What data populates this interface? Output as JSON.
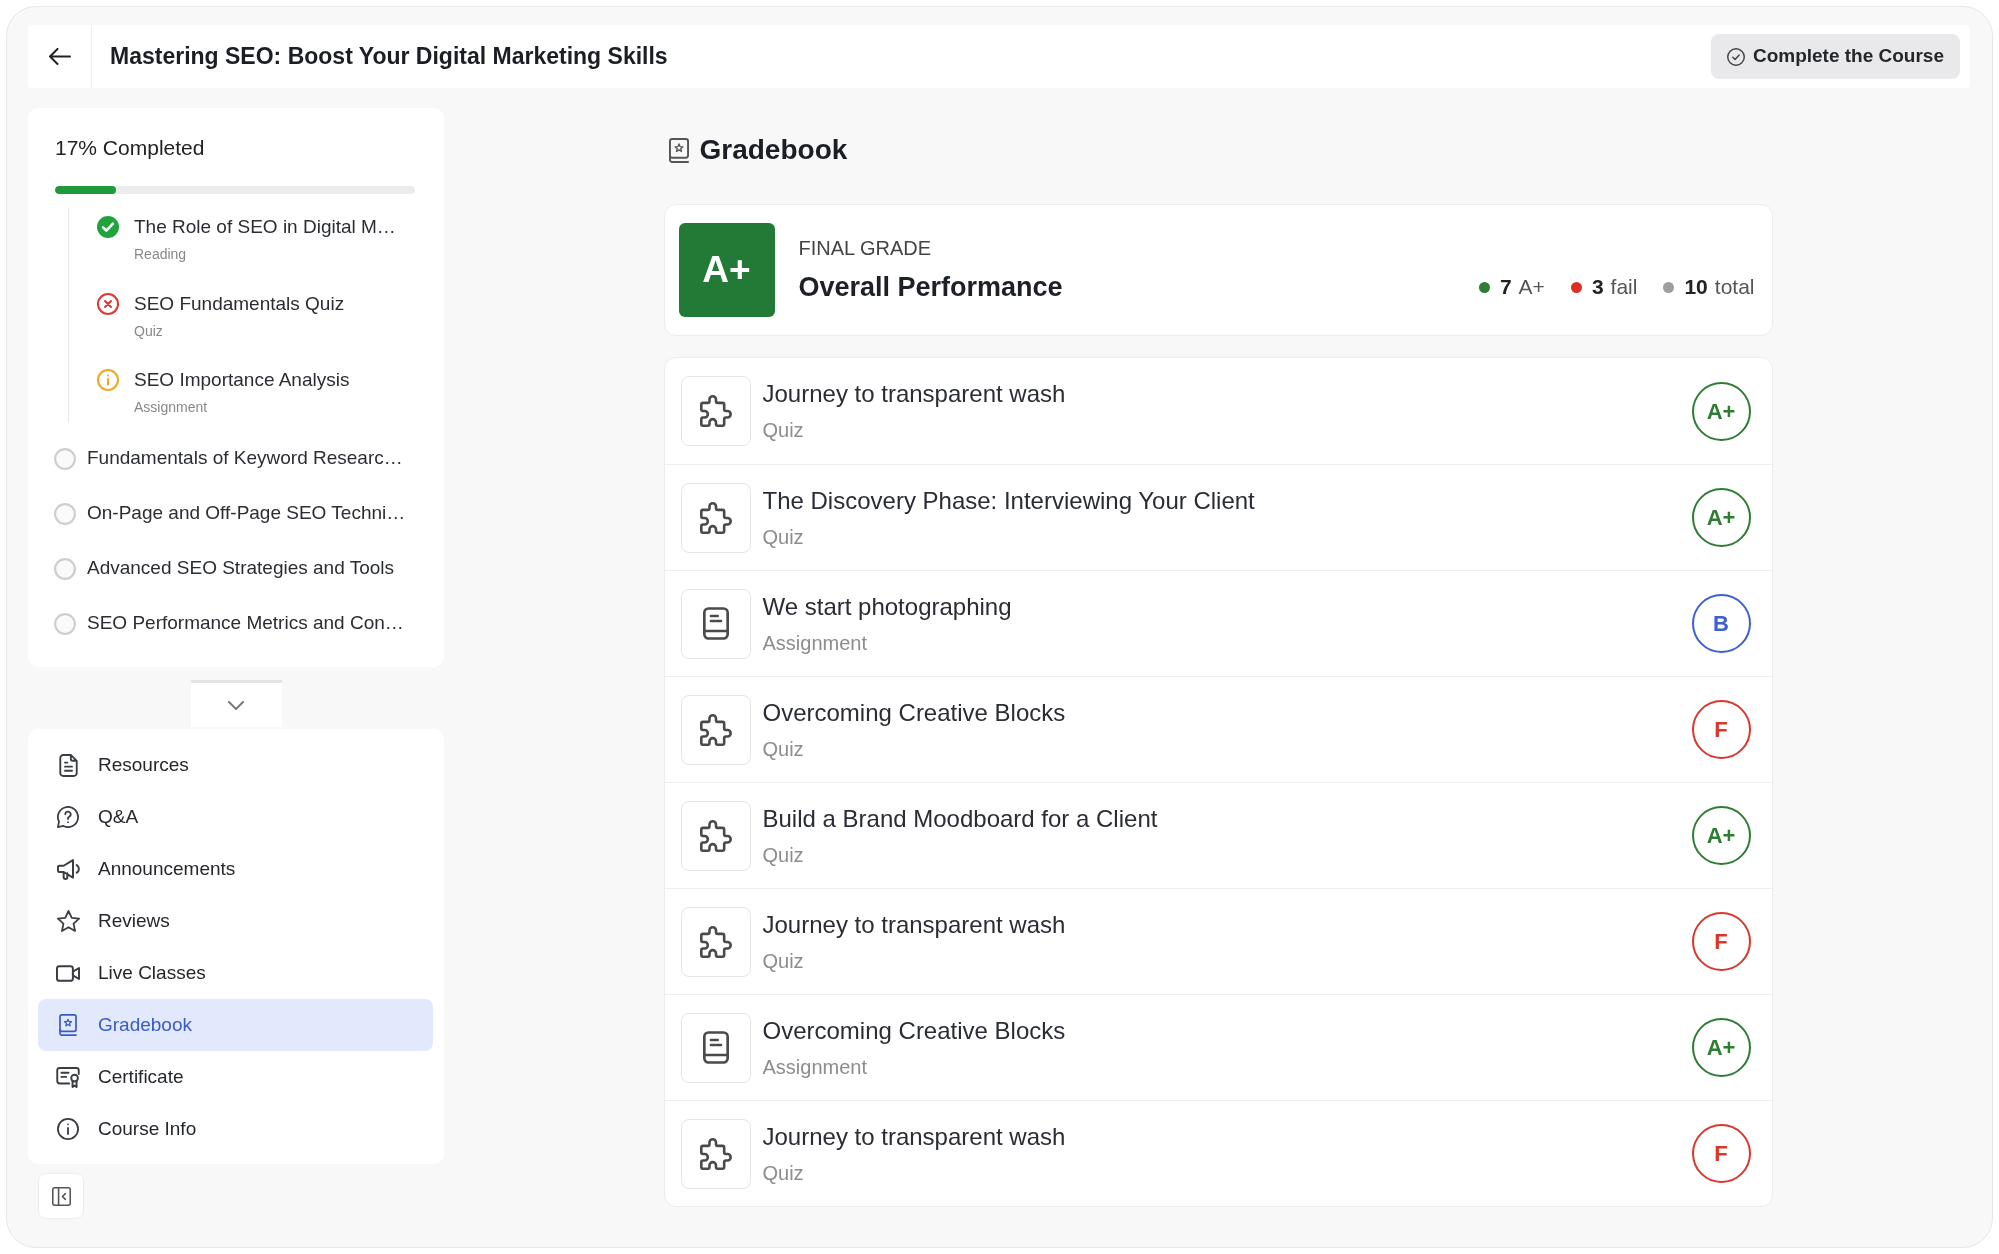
{
  "header": {
    "title": "Mastering SEO: Boost Your Digital Marketing Skills",
    "action": "Complete the Course"
  },
  "sidebar": {
    "progress": {
      "label": "17% Completed",
      "level": 0.17
    },
    "outline": [
      {
        "children": [
          {
            "title": "The Role of SEO in Digital M…",
            "type": "Reading",
            "kind": "done"
          },
          {
            "title": "SEO Fundamentals Quiz",
            "type": "Quiz",
            "kind": "failed"
          },
          {
            "title": "SEO Importance Analysis",
            "type": "Assignment",
            "kind": "pending"
          }
        ]
      },
      {
        "title": "Fundamentals of Keyword Researc…",
        "completed": false
      },
      {
        "title": "On-Page and Off-Page SEO Techni…",
        "completed": false
      },
      {
        "title": "Advanced SEO Strategies and Tools",
        "completed": false
      },
      {
        "title": "SEO Performance Metrics and Con…",
        "completed": false
      }
    ],
    "toggle": {
      "expanded": false
    },
    "menu": [
      {
        "label": "Resources",
        "kind": "resources",
        "selected": false
      },
      {
        "label": "Q&A",
        "kind": "qa",
        "selected": false
      },
      {
        "label": "Announcements",
        "kind": "announcements",
        "selected": false
      },
      {
        "label": "Reviews",
        "kind": "reviews",
        "selected": false
      },
      {
        "label": "Live Classes",
        "kind": "live",
        "selected": false
      },
      {
        "label": "Gradebook",
        "kind": "gradebook",
        "selected": true
      },
      {
        "label": "Certificate",
        "kind": "certificate",
        "selected": false
      },
      {
        "label": "Course Info",
        "kind": "info",
        "selected": false
      }
    ]
  },
  "gradebook": {
    "title": "Gradebook",
    "final": {
      "grade": "A+",
      "eyebrow": "FINAL GRADE",
      "title": "Overall Performance",
      "stats": [
        {
          "count": "7",
          "label": "A+",
          "color": "#2e7d32"
        },
        {
          "count": "3",
          "label": "fail",
          "color": "#d93025"
        },
        {
          "count": "10",
          "label": "total",
          "color": "#9e9e9e"
        }
      ]
    },
    "items": [
      {
        "title": "Journey to transparent wash",
        "type": "Quiz",
        "kind": "quiz",
        "grade": "A+",
        "color": "#2e7d32"
      },
      {
        "title": "The Discovery Phase: Interviewing Your Client",
        "type": "Quiz",
        "kind": "quiz",
        "grade": "A+",
        "color": "#2e7d32"
      },
      {
        "title": "We start photographing",
        "type": "Assignment",
        "kind": "assignment",
        "grade": "B",
        "color": "#3d5fd3"
      },
      {
        "title": "Overcoming Creative Blocks",
        "type": "Quiz",
        "kind": "quiz",
        "grade": "F",
        "color": "#d9372b"
      },
      {
        "title": "Build a Brand Moodboard for a Client",
        "type": "Quiz",
        "kind": "quiz",
        "grade": "A+",
        "color": "#2e7d32"
      },
      {
        "title": "Journey to transparent wash",
        "type": "Quiz",
        "kind": "quiz",
        "grade": "F",
        "color": "#d9372b"
      },
      {
        "title": "Overcoming Creative Blocks",
        "type": "Assignment",
        "kind": "assignment",
        "grade": "A+",
        "color": "#2e7d32"
      },
      {
        "title": "Journey to transparent wash",
        "type": "Quiz",
        "kind": "quiz",
        "grade": "F",
        "color": "#d9372b"
      }
    ]
  }
}
